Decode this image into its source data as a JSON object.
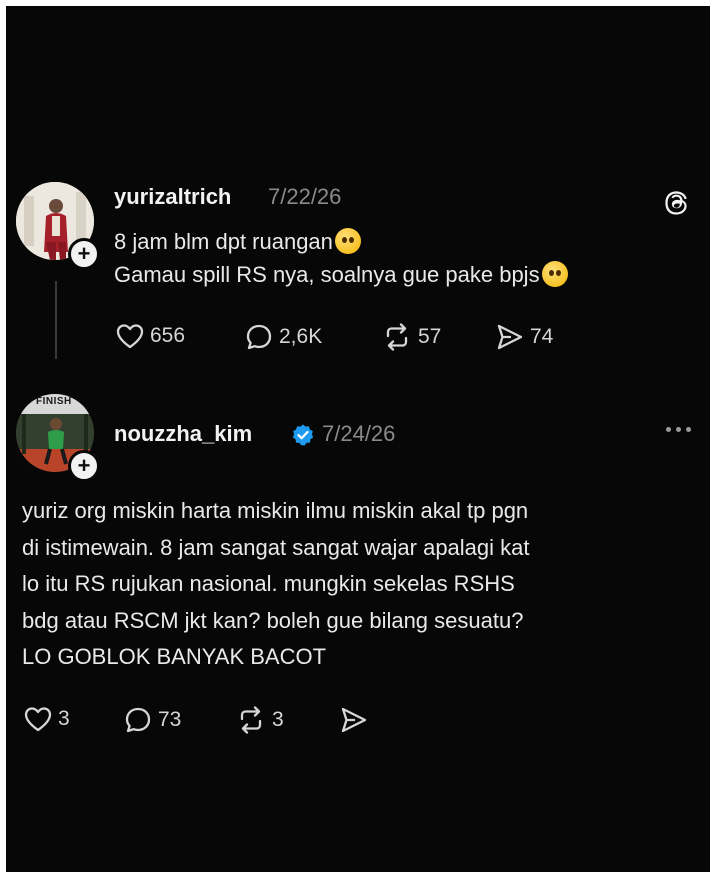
{
  "app": {
    "icon": "threads-logo-icon"
  },
  "post": {
    "username": "yurizaltrich",
    "date": "7/22/26",
    "lines": [
      "8 jam blm dpt ruangan",
      "Gamau spill RS nya, soalnya gue pake bpjs"
    ],
    "emojis": [
      "crying-face-emoji",
      "pleading-face-emoji"
    ],
    "likes": "656",
    "comments": "2,6K",
    "reposts": "57",
    "shares": "74"
  },
  "reply": {
    "avatar_text": "FINISH",
    "username": "nouzzha_kim",
    "verified": true,
    "date": "7/24/26",
    "lines": [
      "yuriz org miskin harta miskin ilmu miskin akal tp pgn",
      "di istimewain. 8 jam sangat sangat wajar apalagi kat",
      "lo itu RS rujukan nasional. mungkin sekelas RSHS",
      "bdg atau RSCM jkt kan? boleh gue bilang sesuatu?",
      "LO GOBLOK BANYAK BACOT"
    ],
    "likes": "3",
    "comments": "73",
    "reposts": "3"
  },
  "colors": {
    "background": "#070707",
    "text": "#e9e9e9",
    "muted": "#8a8a8a",
    "verified": "#1d9bf0"
  }
}
